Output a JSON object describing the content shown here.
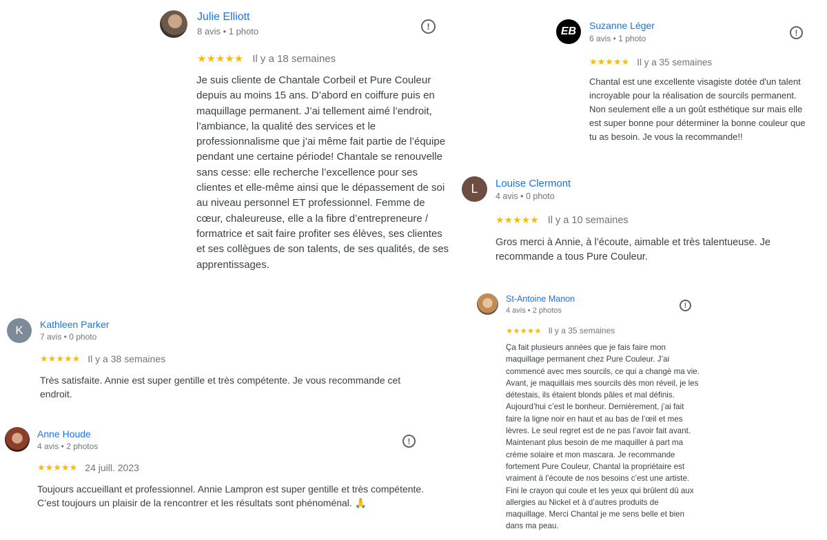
{
  "colors": {
    "name_link": "#1a73e8",
    "star": "#fbbc04",
    "meta": "#70757a",
    "body_text": "#3c4043",
    "avatar_kathleen": "#7d8a99",
    "avatar_louise": "#6d4c41",
    "avatar_suzanne": "#000000"
  },
  "reviews": {
    "julie": {
      "name": "Julie Elliott",
      "meta": "8 avis • 1 photo",
      "stars": "★★★★★",
      "rating": 5,
      "date": "Il y a 18 semaines",
      "text": "Je suis cliente de Chantale Corbeil et Pure Couleur depuis au moins 15 ans. D’abord en coiffure puis en maquillage permanent. J’ai tellement aimé l’endroit, l’ambiance, la qualité des services et le professionnalisme que j’ai même fait partie de l’équipe pendant une certaine période! Chantale se renouvelle sans cesse: elle recherche l’excellence pour ses clientes et elle-même ainsi que le dépassement de soi au niveau personnel ET professionnel. Femme de cœur, chaleureuse, elle a la fibre d’entrepreneure / formatrice et sait faire profiter ses élèves, ses clientes et ses collègues de son talents, de ses qualités, de ses apprentissages."
    },
    "suzanne": {
      "name": "Suzanne Léger",
      "meta": "6 avis • 1 photo",
      "avatar_logo": "EB",
      "stars": "★★★★★",
      "rating": 5,
      "date": "Il y a 35 semaines",
      "text": "Chantal est une excellente visagiste dotée d'un talent incroyable pour la réalisation de sourcils permanent. Non seulement elle a un goût esthétique sur mais elle est super bonne pour déterminer la bonne couleur que tu as besoin. Je vous la recommande!!"
    },
    "louise": {
      "name": "Louise Clermont",
      "meta": "4 avis • 0 photo",
      "avatar_letter": "L",
      "stars": "★★★★★",
      "rating": 5,
      "date": "Il y a 10 semaines",
      "text": "Gros merci à Annie, à l’écoute, aimable et très talentueuse. Je recommande a tous Pure Couleur."
    },
    "kathleen": {
      "name": "Kathleen Parker",
      "meta": "7 avis • 0 photo",
      "avatar_letter": "K",
      "stars": "★★★★★",
      "rating": 5,
      "date": "Il y a 38 semaines",
      "text": "Très satisfaite. Annie est super gentille et très compétente. Je vous recommande cet endroit."
    },
    "anne": {
      "name": "Anne Houde",
      "meta": "4 avis • 2 photos",
      "stars": "★★★★★",
      "rating": 5,
      "date": "24 juill. 2023",
      "text": "Toujours accueillant et professionnel. Annie Lampron est super gentille et très compétente. C’est toujours un plaisir de la rencontrer et les résultats sont phénoménal.",
      "emoji": "🙏"
    },
    "manon": {
      "name": "St-Antoine Manon",
      "meta": "4 avis • 2 photos",
      "stars": "★★★★★",
      "rating": 5,
      "date": "Il y a 35 semaines",
      "text": "Ça fait plusieurs années que je fais faire mon maquillage permanent chez Pure Couleur. J’ai commencé avec mes sourcils, ce qui a changé ma vie. Avant, je maquillais mes sourcils dès mon réveil, je les détestais, ils étaient blonds pâles et mal définis. Aujourd’hui c’est le bonheur. Dernièrement, j’ai fait faire la ligne noir en haut et au bas de l’œil et mes lèvres. Le seul regret est de ne pas l’avoir fait avant. Maintenant plus besoin de me maquiller à part ma crème solaire et mon mascara. Je recommande fortement Pure Couleur, Chantal la propriétaire est vraiment à l’écoute de nos besoins c’est une artiste. Fini le crayon qui coule et les yeux qui brûlent dû aux allergies au Nickel et à d’autres produits de maquillage. Merci Chantal je me sens belle et bien dans ma peau."
    }
  },
  "icons": {
    "flag": "!"
  }
}
